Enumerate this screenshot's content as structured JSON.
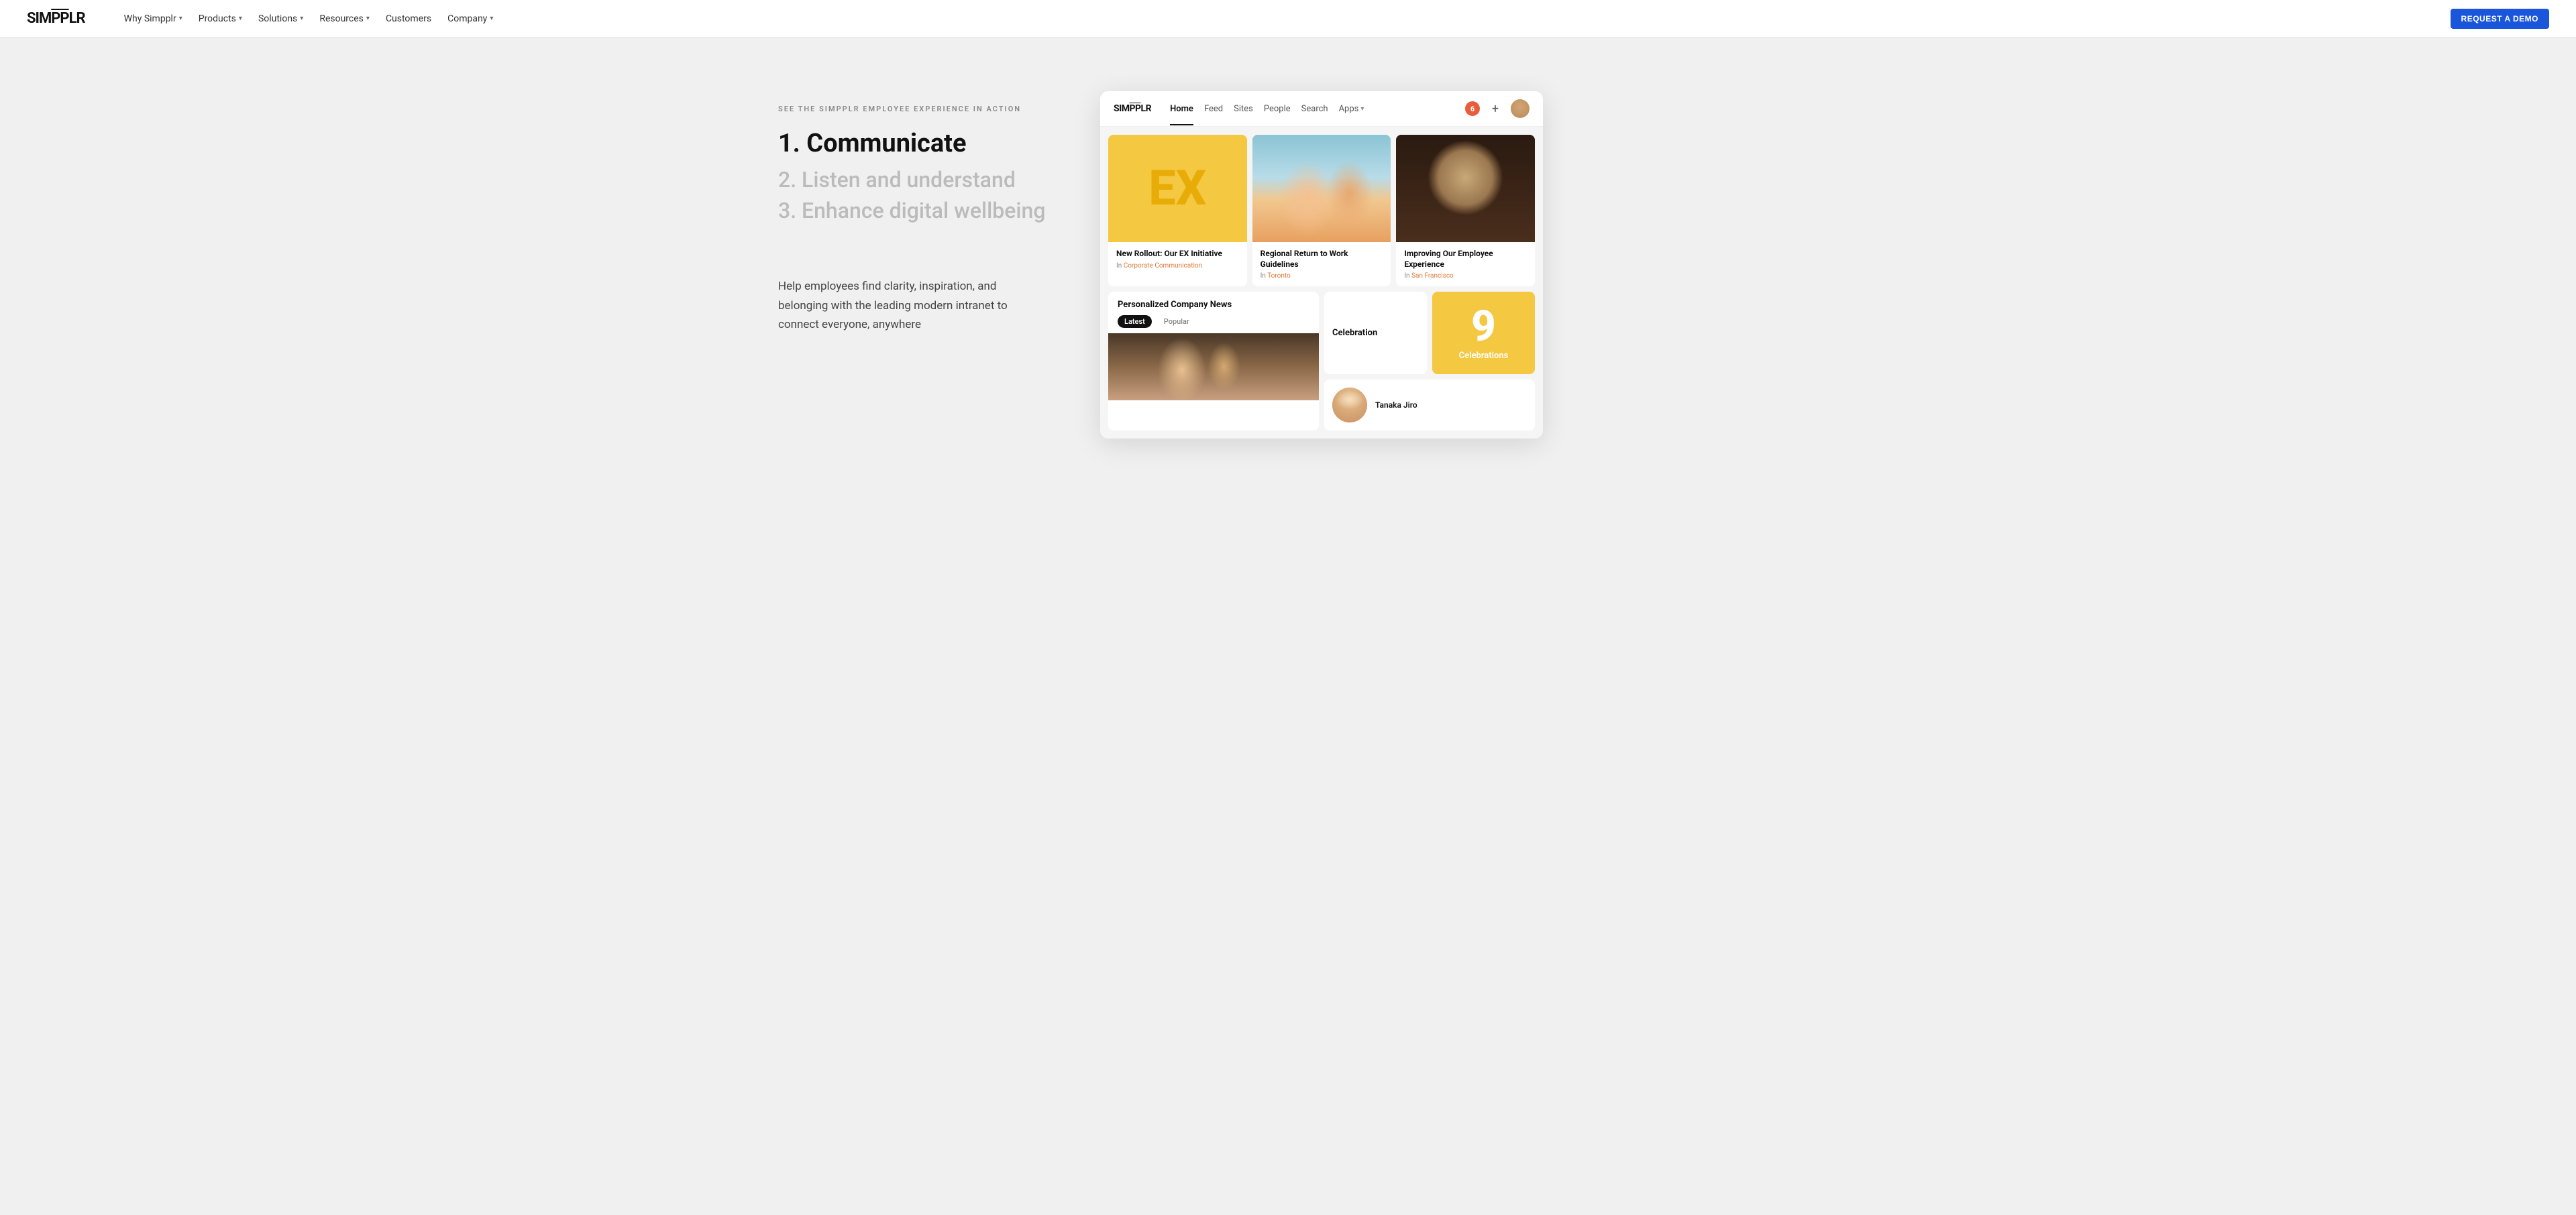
{
  "brand": {
    "name_before": "SIM",
    "name_overline": "PP",
    "name_after": "LR"
  },
  "navbar": {
    "logo": "SIMPPLR",
    "links": [
      {
        "label": "Why Simpplr",
        "has_dropdown": true
      },
      {
        "label": "Products",
        "has_dropdown": true
      },
      {
        "label": "Solutions",
        "has_dropdown": true
      },
      {
        "label": "Resources",
        "has_dropdown": true
      },
      {
        "label": "Customers",
        "has_dropdown": false
      },
      {
        "label": "Company",
        "has_dropdown": true
      }
    ],
    "cta_label": "REQUEST A DEMO"
  },
  "hero": {
    "eyebrow": "SEE THE SIMPPLR EMPLOYEE EXPERIENCE IN ACTION",
    "step1": "1. Communicate",
    "step2": "2. Listen and understand",
    "step3": "3. Enhance digital wellbeing",
    "description": "Help employees find clarity, inspiration, and belonging with the leading modern intranet to connect everyone, anywhere"
  },
  "app_mockup": {
    "logo": "SIMPPLR",
    "nav_items": [
      {
        "label": "Home",
        "active": true
      },
      {
        "label": "Feed",
        "active": false
      },
      {
        "label": "Sites",
        "active": false
      },
      {
        "label": "People",
        "active": false
      },
      {
        "label": "Search",
        "active": false
      },
      {
        "label": "Apps",
        "active": false,
        "has_dropdown": true
      }
    ],
    "notification_count": "6",
    "cards": {
      "ex_card": {
        "text": "EX"
      },
      "news_card1": {
        "title": "New Rollout: Our EX Initiative",
        "category_label": "In",
        "category": "Corporate Communication",
        "category_color": "#e07b3a"
      },
      "news_card2": {
        "title": "Regional Return to Work Guidelines",
        "category_label": "In",
        "category": "Toronto",
        "category_color": "#e07b3a"
      },
      "news_card3": {
        "title": "Improving Our Employee Experience",
        "category_label": "In",
        "category": "San Francisco",
        "category_color": "#e07b3a"
      },
      "personalized_news": {
        "header": "Personalized Company News",
        "tab_latest": "Latest",
        "tab_popular": "Popular"
      },
      "celebration": {
        "number": "9",
        "label": "Celebrations",
        "header": "Celebration"
      },
      "profile": {
        "name": "Tanaka Jiro"
      }
    }
  }
}
